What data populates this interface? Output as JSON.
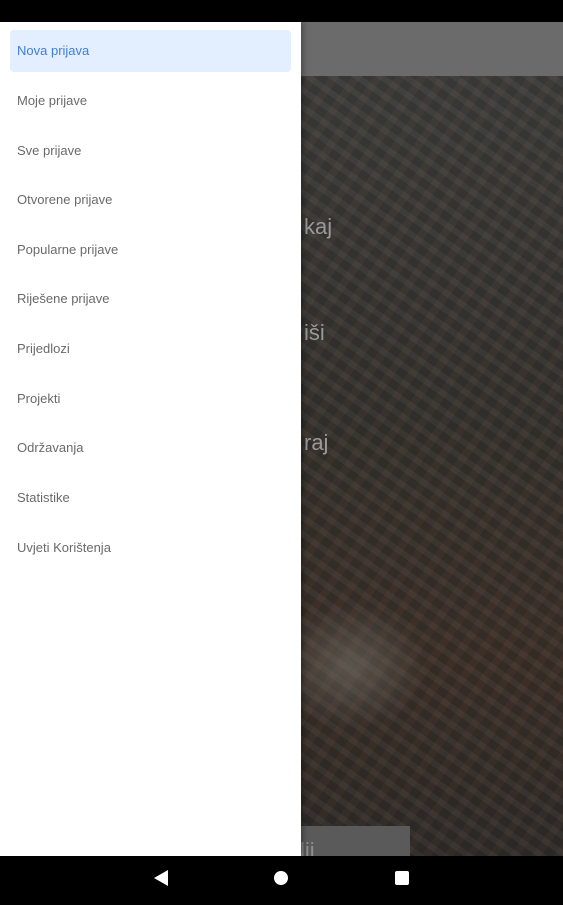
{
  "drawer": {
    "items": [
      {
        "label": "Nova prijava",
        "active": true
      },
      {
        "label": "Moje prijave"
      },
      {
        "label": "Sve prijave"
      },
      {
        "label": "Otvorene prijave"
      },
      {
        "label": "Popularne prijave"
      },
      {
        "label": "Riješene prijave"
      },
      {
        "label": "Prijedlozi"
      },
      {
        "label": "Projekti"
      },
      {
        "label": "Održavanja"
      },
      {
        "label": "Statistike"
      },
      {
        "label": "Uvjeti Korištenja"
      }
    ]
  },
  "background": {
    "fragment_1": "kaj",
    "fragment_2": "iši",
    "fragment_3": "raj",
    "button_fragment": "lji"
  },
  "colors": {
    "accent": "#3d7fdb",
    "active_bg": "#e3eeff",
    "text": "#6a6a6a"
  },
  "icons": {
    "back": "back-icon",
    "home": "home-icon",
    "recents": "recents-icon"
  }
}
